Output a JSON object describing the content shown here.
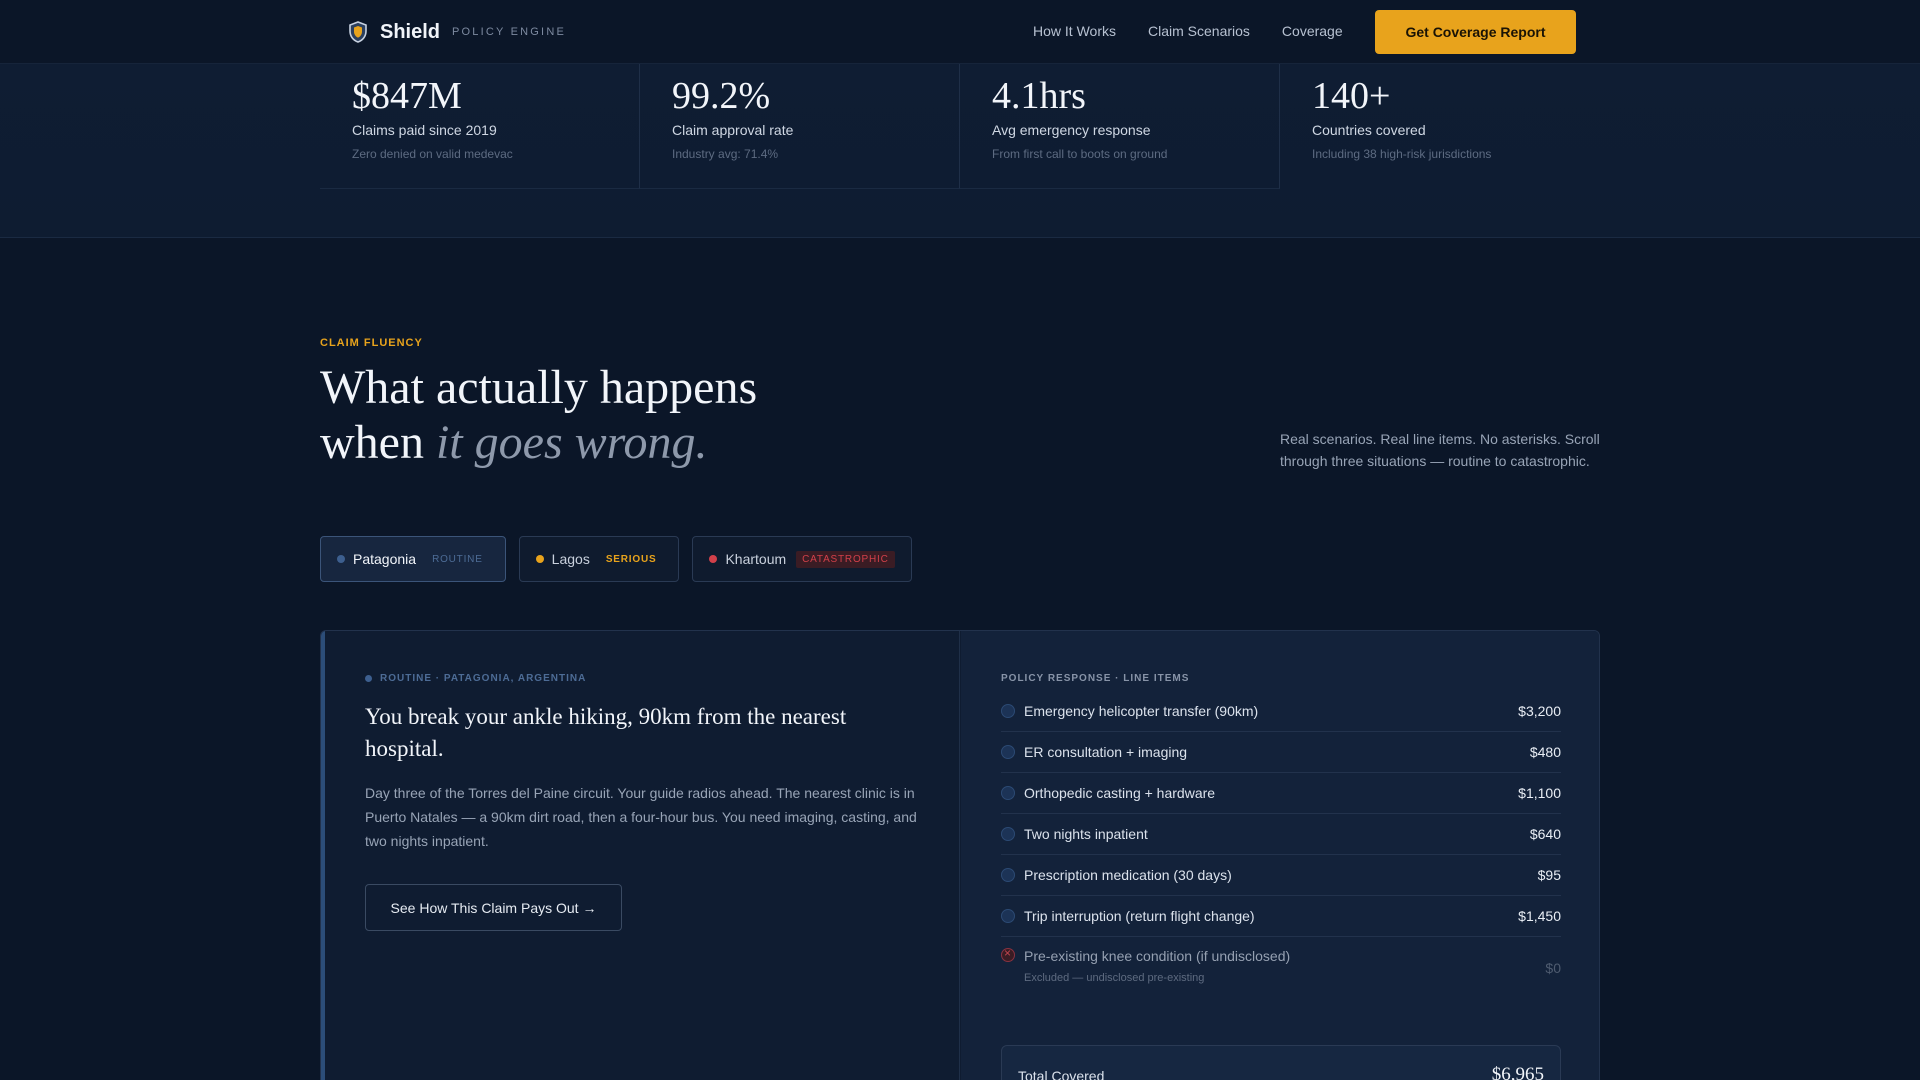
{
  "nav": {
    "brand": "Shield",
    "brand_sub": "POLICY ENGINE",
    "links": [
      "How It Works",
      "Claim Scenarios",
      "Coverage"
    ],
    "cta": "Get Coverage Report"
  },
  "stats": [
    {
      "value": "$847M",
      "label": "Claims paid since 2019",
      "note": "Zero denied on valid medevac"
    },
    {
      "value": "99.2%",
      "label": "Claim approval rate",
      "note": "Industry avg: 71.4%"
    },
    {
      "value": "4.1hrs",
      "label": "Avg emergency response",
      "note": "From first call to boots on ground"
    },
    {
      "value": "140+",
      "label": "Countries covered",
      "note": "Including 38 high-risk jurisdictions"
    }
  ],
  "section": {
    "eyebrow": "CLAIM FLUENCY",
    "headline_line1": "What actually happens",
    "headline_line2_prefix": "when ",
    "headline_line2_em": "it goes wrong.",
    "intro": "Real scenarios. Real line items. No asterisks. Scroll through three situations — routine to catastrophic."
  },
  "tabs": [
    {
      "label": "Patagonia",
      "badge": "ROUTINE",
      "color": "#3d5f8f",
      "badge_color": "#4d6c96",
      "badge_bg": "transparent"
    },
    {
      "label": "Lagos",
      "badge": "SERIOUS",
      "color": "#e8a31c",
      "badge_color": "#e8a31c",
      "badge_bg": "transparent"
    },
    {
      "label": "Khartoum",
      "badge": "CATASTROPHIC",
      "color": "#d2404a",
      "badge_color": "#d2404a",
      "badge_bg": "#3a1c24"
    }
  ],
  "scenario": {
    "tag": "ROUTINE · PATAGONIA, ARGENTINA",
    "title": "You break your ankle hiking, 90km from the nearest hospital.",
    "body": "Day three of the Torres del Paine circuit. Your guide radios ahead. The nearest clinic is in Puerto Natales — a 90km dirt road, then a four-hour bus. You need imaging, casting, and two nights inpatient.",
    "button": "See How This Claim Pays Out →"
  },
  "policy": {
    "title": "POLICY RESPONSE · LINE ITEMS",
    "items": [
      {
        "name": "Emergency helicopter transfer (90km)",
        "amount": "$3,200"
      },
      {
        "name": "ER consultation + imaging",
        "amount": "$480"
      },
      {
        "name": "Orthopedic casting + hardware",
        "amount": "$1,100"
      },
      {
        "name": "Two nights inpatient",
        "amount": "$640"
      },
      {
        "name": "Prescription medication (30 days)",
        "amount": "$95"
      },
      {
        "name": "Trip interruption (return flight change)",
        "amount": "$1,450"
      }
    ],
    "excluded": {
      "name": "Pre-existing knee condition (if undisclosed)",
      "sub": "Excluded — undisclosed pre-existing",
      "amount": "$0"
    },
    "total_label": "Total Covered",
    "total_value": "$6,965"
  }
}
